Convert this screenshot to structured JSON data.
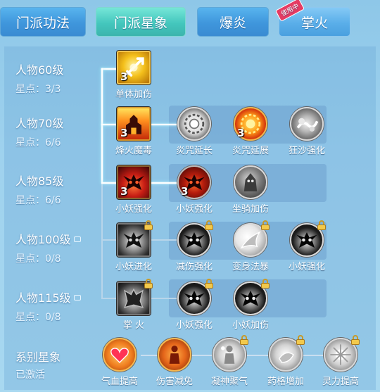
{
  "tabs": [
    {
      "label": "门派功法",
      "style": "blue"
    },
    {
      "label": "门派星象",
      "style": "teal"
    },
    {
      "label": "爆炎",
      "style": "blue"
    },
    {
      "label": "掌火",
      "style": "light",
      "badge": "使用中"
    }
  ],
  "rows": [
    {
      "level": "人物60级",
      "stars": "星点：3/3",
      "locked": false
    },
    {
      "level": "人物70级",
      "stars": "星点：6/6",
      "locked": false
    },
    {
      "level": "人物85级",
      "stars": "星点：6/6",
      "locked": false
    },
    {
      "level": "人物100级",
      "stars": "星点：0/8",
      "locked": true
    },
    {
      "level": "人物115级",
      "stars": "星点：0/8",
      "locked": true
    }
  ],
  "skills": {
    "r1": [
      {
        "name": "单体加伤",
        "count": "3",
        "icon": "sword-burst-icon",
        "shape": "square",
        "bg": "gold",
        "locked": false
      }
    ],
    "r2": [
      {
        "name": "烽火魔毒",
        "count": "3",
        "icon": "burning-tower-icon",
        "shape": "square",
        "bg": "fire",
        "locked": false
      },
      {
        "name": "炎咒延长",
        "count": "",
        "icon": "rune-wheel-icon",
        "shape": "circle",
        "bg": "white",
        "locked": false
      },
      {
        "name": "炎咒延展",
        "count": "3",
        "icon": "fire-rune-icon",
        "shape": "circle",
        "bg": "fire",
        "locked": false
      },
      {
        "name": "狂沙强化",
        "count": "",
        "icon": "sandstorm-icon",
        "shape": "circle",
        "bg": "grey",
        "locked": false
      }
    ],
    "r3": [
      {
        "name": "小妖强化",
        "count": "3",
        "icon": "demon-mask-icon",
        "shape": "square",
        "bg": "red",
        "locked": false
      },
      {
        "name": "小妖强化",
        "count": "3",
        "icon": "demon-mask-icon",
        "shape": "circle",
        "bg": "redmask",
        "locked": false
      },
      {
        "name": "坐骑加伤",
        "count": "",
        "icon": "mount-beast-icon",
        "shape": "circle",
        "bg": "mount",
        "locked": false
      }
    ],
    "r4": [
      {
        "name": "小妖进化",
        "count": "",
        "icon": "demon-mask-icon",
        "shape": "square",
        "bg": "dark",
        "locked": true
      },
      {
        "name": "减伤强化",
        "count": "",
        "icon": "demon-mask-icon",
        "shape": "circle",
        "bg": "black",
        "locked": true
      },
      {
        "name": "变身法暴",
        "count": "",
        "icon": "wing-slash-icon",
        "shape": "circle",
        "bg": "wing",
        "locked": true
      },
      {
        "name": "小妖强化",
        "count": "",
        "icon": "demon-mask-icon",
        "shape": "circle",
        "bg": "black",
        "locked": true
      }
    ],
    "r5": [
      {
        "name": "掌 火",
        "count": "",
        "icon": "demon-armor-icon",
        "shape": "square",
        "bg": "dark",
        "locked": true
      },
      {
        "name": "小妖强化",
        "count": "",
        "icon": "demon-mask-icon",
        "shape": "circle",
        "bg": "black",
        "locked": true
      },
      {
        "name": "小妖加伤",
        "count": "",
        "icon": "demon-mask-icon",
        "shape": "circle",
        "bg": "black",
        "locked": true
      }
    ]
  },
  "system": {
    "title": "系别星象",
    "status": "已激活",
    "nodes": [
      {
        "name": "气血提高",
        "icon": "heart-icon",
        "bg": "heart",
        "locked": false
      },
      {
        "name": "伤害减免",
        "icon": "person-shield-icon",
        "bg": "person",
        "locked": false
      },
      {
        "name": "凝神聚气",
        "icon": "focus-aura-icon",
        "bg": "silver",
        "locked": true
      },
      {
        "name": "药格增加",
        "icon": "potion-icon",
        "bg": "silver",
        "locked": true
      },
      {
        "name": "灵力提高",
        "icon": "spirit-burst-icon",
        "bg": "silver",
        "locked": true
      }
    ]
  }
}
